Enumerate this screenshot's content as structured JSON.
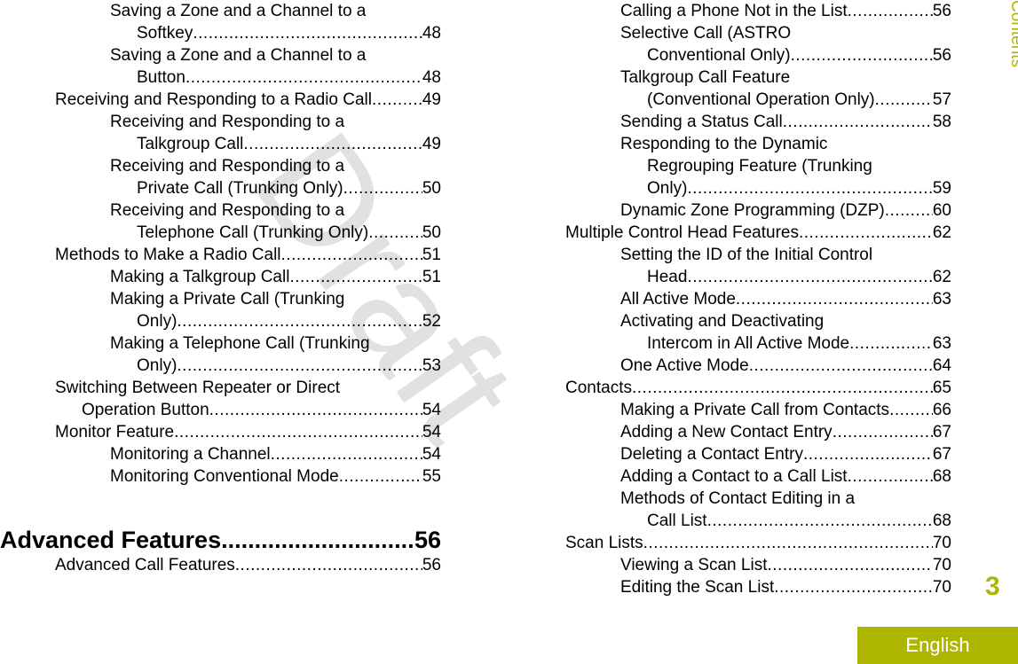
{
  "watermark": "Draft",
  "side_label": "Contents",
  "page_number": "3",
  "language_tab": "English",
  "accent_color": "#adb600",
  "heading": {
    "text": "Advanced Features",
    "page": "56"
  },
  "left_column": [
    {
      "level": 2,
      "lines": [
        "Saving a Zone and a Channel to a",
        "Softkey"
      ],
      "page": "48"
    },
    {
      "level": 2,
      "lines": [
        "Saving a Zone and a Channel to a",
        "Button"
      ],
      "page": "48"
    },
    {
      "level": 1,
      "lines": [
        "Receiving and Responding to a Radio Call"
      ],
      "page": "49"
    },
    {
      "level": 2,
      "lines": [
        "Receiving and Responding to a",
        "Talkgroup Call"
      ],
      "page": "49"
    },
    {
      "level": 2,
      "lines": [
        "Receiving and Responding to a",
        "Private Call (Trunking Only)"
      ],
      "page": "50"
    },
    {
      "level": 2,
      "lines": [
        "Receiving and Responding to a",
        "Telephone Call (Trunking Only)"
      ],
      "page": "50"
    },
    {
      "level": 1,
      "lines": [
        "Methods to Make a Radio Call"
      ],
      "page": "51"
    },
    {
      "level": 2,
      "lines": [
        "Making a Talkgroup Call"
      ],
      "page": "51"
    },
    {
      "level": 2,
      "lines": [
        "Making a Private Call (Trunking",
        "Only)"
      ],
      "page": "52"
    },
    {
      "level": 2,
      "lines": [
        "Making a Telephone Call (Trunking",
        "Only)"
      ],
      "page": "53"
    },
    {
      "level": 1,
      "lines": [
        "Switching Between Repeater or Direct",
        "Operation Button"
      ],
      "page": "54"
    },
    {
      "level": 1,
      "lines": [
        "Monitor Feature"
      ],
      "page": "54"
    },
    {
      "level": 2,
      "lines": [
        "Monitoring a Channel"
      ],
      "page": "54"
    },
    {
      "level": 2,
      "lines": [
        "Monitoring Conventional Mode"
      ],
      "page": "55"
    }
  ],
  "left_after_heading": [
    {
      "level": 1,
      "lines": [
        "Advanced Call Features"
      ],
      "page": "56"
    }
  ],
  "right_column": [
    {
      "level": 2,
      "lines": [
        "Calling a Phone Not in the List"
      ],
      "page": "56"
    },
    {
      "level": 2,
      "lines": [
        "Selective Call (ASTRO",
        "Conventional Only)"
      ],
      "page": "56"
    },
    {
      "level": 2,
      "lines": [
        "Talkgroup Call Feature",
        "(Conventional Operation Only)"
      ],
      "page": "57"
    },
    {
      "level": 2,
      "lines": [
        "Sending a Status Call"
      ],
      "page": "58"
    },
    {
      "level": 2,
      "lines": [
        "Responding to the Dynamic",
        "Regrouping Feature (Trunking",
        "Only)"
      ],
      "page": "59"
    },
    {
      "level": 2,
      "lines": [
        "Dynamic Zone Programming (DZP)"
      ],
      "page": "60"
    },
    {
      "level": 1,
      "lines": [
        "Multiple Control Head Features"
      ],
      "page": "62"
    },
    {
      "level": 2,
      "lines": [
        "Setting the ID of the Initial Control",
        "Head"
      ],
      "page": "62"
    },
    {
      "level": 2,
      "lines": [
        "All Active Mode"
      ],
      "page": "63"
    },
    {
      "level": 2,
      "lines": [
        "Activating and Deactivating",
        "Intercom in All Active Mode"
      ],
      "page": "63"
    },
    {
      "level": 2,
      "lines": [
        "One Active Mode"
      ],
      "page": "64"
    },
    {
      "level": 1,
      "lines": [
        "Contacts"
      ],
      "page": "65"
    },
    {
      "level": 2,
      "lines": [
        "Making a Private Call from Contacts"
      ],
      "page": "66"
    },
    {
      "level": 2,
      "lines": [
        "Adding a New Contact Entry"
      ],
      "page": "67"
    },
    {
      "level": 2,
      "lines": [
        "Deleting a Contact Entry"
      ],
      "page": "67"
    },
    {
      "level": 2,
      "lines": [
        "Adding a Contact to a Call List"
      ],
      "page": "68"
    },
    {
      "level": 2,
      "lines": [
        "Methods of Contact Editing in a",
        "Call List"
      ],
      "page": "68"
    },
    {
      "level": 1,
      "lines": [
        "Scan Lists"
      ],
      "page": "70"
    },
    {
      "level": 2,
      "lines": [
        "Viewing a Scan List"
      ],
      "page": "70"
    },
    {
      "level": 2,
      "lines": [
        "Editing the Scan List"
      ],
      "page": "70"
    }
  ]
}
